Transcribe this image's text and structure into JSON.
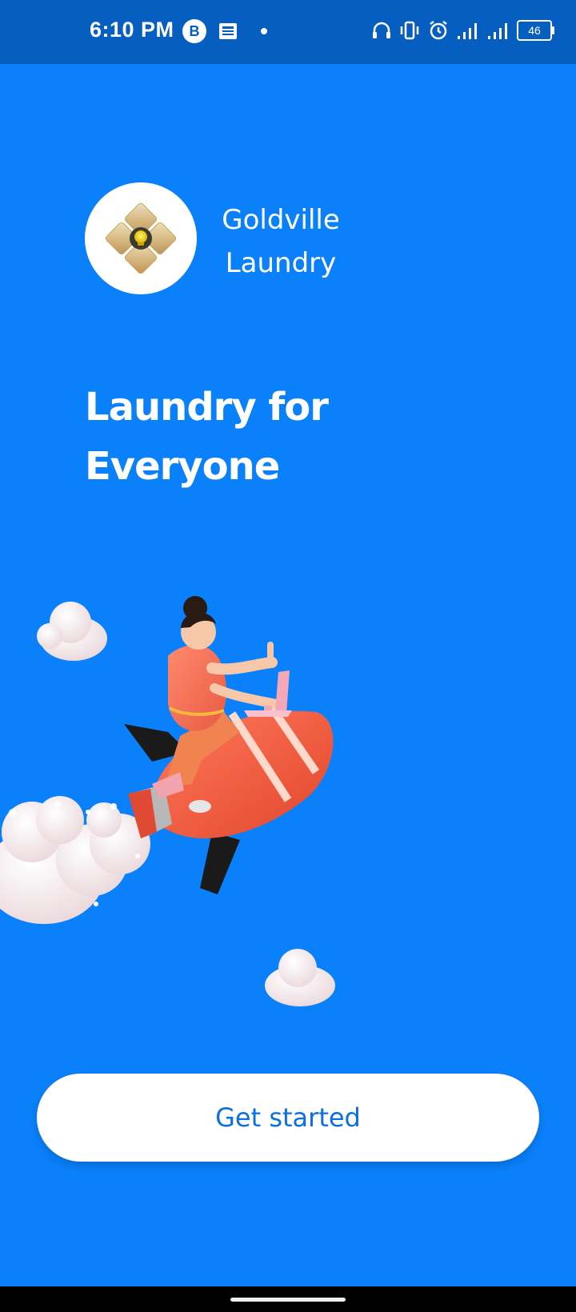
{
  "status_bar": {
    "time": "6:10 PM",
    "badge_letter": "B",
    "battery_level": "46",
    "icons": [
      "b-circle-icon",
      "news-icon",
      "dot-icon",
      "headphones-icon",
      "vibrate-icon",
      "alarm-icon",
      "signal-icon",
      "signal-icon",
      "battery-icon"
    ]
  },
  "brand": {
    "name_line1": "Goldville",
    "name_line2": "Laundry",
    "logo_icon": "diamond-lightbulb-logo-icon"
  },
  "headline": {
    "line1": "Laundry for",
    "line2": "Everyone"
  },
  "illustration": {
    "icon": "woman-riding-rocket-illustration"
  },
  "cta": {
    "label": "Get started"
  },
  "colors": {
    "background": "#0a80fb",
    "status_bar": "#065fc0",
    "button_bg": "#ffffff",
    "button_text": "#0a6fe0",
    "logo_gold": "#d4b77c"
  }
}
